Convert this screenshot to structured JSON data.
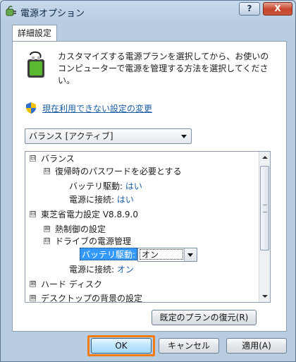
{
  "window": {
    "title": "電源オプション"
  },
  "titlebar": {
    "help_label": "?",
    "close_label": "X"
  },
  "tab": {
    "label": "詳細設定"
  },
  "description": "カスタマイズする電源プランを選択してから、お使いのコンピューターで電源を管理する方法を選択してください。",
  "link": {
    "text": "現在利用できない設定の変更"
  },
  "plan_select": {
    "value": "バランス [アクティブ]"
  },
  "tree": {
    "rows": [
      {
        "expander": "⊟",
        "label": "バランス"
      },
      {
        "expander": "⊟",
        "label": "復帰時のパスワードを必要とする"
      },
      {
        "label": "バッテリ駆動:",
        "value": "はい"
      },
      {
        "label": "電源に接続:",
        "value": "はい"
      },
      {
        "expander": "⊟",
        "label": "東芝省電力設定 V8.8.9.0"
      },
      {
        "expander": "⊞",
        "label": "熱制御の設定"
      },
      {
        "expander": "⊟",
        "label": "ドライブの電源管理"
      },
      {
        "label": "バッテリ駆動:",
        "value": "オン"
      },
      {
        "label": "電源に接続:",
        "value": "オン"
      },
      {
        "expander": "⊞",
        "label": "ハード ディスク"
      },
      {
        "expander": "⊞",
        "label": "デスクトップの背景の設定"
      }
    ],
    "combo_value": "オン"
  },
  "buttons": {
    "restore": "既定のプランの復元(R)",
    "ok": "OK",
    "cancel": "キャンセル",
    "apply": "適用(A)"
  },
  "colors": {
    "link": "#1a5ea6",
    "selection": "#3399ff",
    "highlight": "#f07d12"
  }
}
